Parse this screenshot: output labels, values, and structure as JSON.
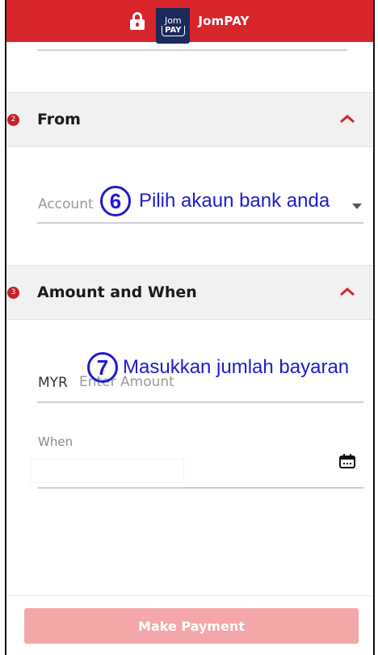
{
  "header": {
    "logo_top": "Jom",
    "logo_bottom": "PAY",
    "brand": "JomPAY",
    "lock_icon": "lock-icon"
  },
  "sections": {
    "from": {
      "step": "2",
      "title": "From",
      "chevron_icon": "chevron-up-icon"
    },
    "amount": {
      "step": "3",
      "title": "Amount and When",
      "chevron_icon": "chevron-up-icon"
    }
  },
  "fields": {
    "account_placeholder": "Account",
    "currency": "MYR",
    "amount_placeholder": "Enter Amount",
    "when_label": "When",
    "calendar_icon": "calendar-icon"
  },
  "annotations": {
    "step6_number": "6",
    "step6_text": "Pilih akaun bank anda",
    "step7_number": "7",
    "step7_text": "Masukkan jumlah bayaran"
  },
  "footer": {
    "make_payment_label": "Make Payment"
  },
  "colors": {
    "brand_red": "#d8242b",
    "logo_navy": "#1c2a5a",
    "annotation_blue": "#1c1ccc",
    "button_disabled": "#f3a7a9"
  }
}
